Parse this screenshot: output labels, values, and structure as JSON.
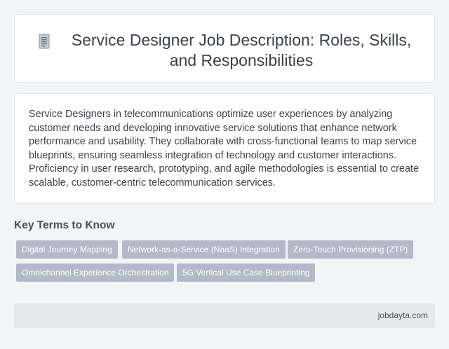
{
  "header": {
    "title": "Service Designer Job Description: Roles, Skills, and Responsibilities",
    "icon": "document-icon"
  },
  "description": {
    "text": "Service Designers in telecommunications optimize user experiences by analyzing customer needs and developing innovative service solutions that enhance network performance and usability. They collaborate with cross-functional teams to map service blueprints, ensuring seamless integration of technology and customer interactions. Proficiency in user research, prototyping, and agile methodologies is essential to create scalable, customer-centric telecommunication services."
  },
  "key_terms": {
    "heading": "Key Terms to Know",
    "tags": [
      "Digital Journey Mapping",
      "Network-as-a-Service (NaaS) Integration",
      "Zero-Touch Provisioning (ZTP)",
      "Omnichannel Experience Orchestration",
      "5G Vertical Use Case Blueprinting"
    ]
  },
  "footer": {
    "site": "jobdayta.com"
  },
  "colors": {
    "background": "#f3f4f6",
    "card": "#ffffff",
    "tag": "#b4b9c9",
    "footer": "#e6eaea"
  }
}
